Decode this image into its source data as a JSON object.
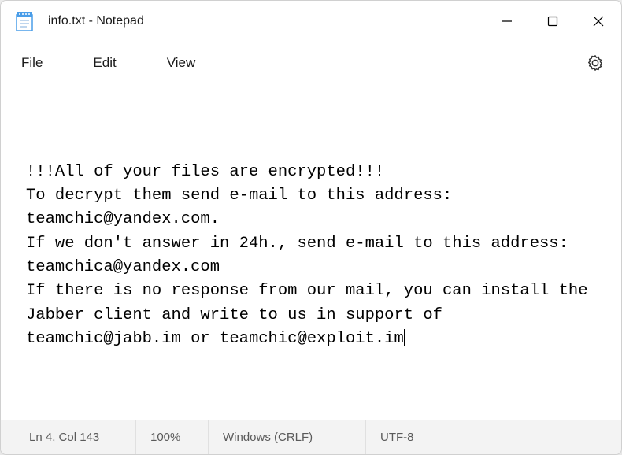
{
  "window": {
    "title": "info.txt - Notepad"
  },
  "menu": {
    "file": "File",
    "edit": "Edit",
    "view": "View"
  },
  "editor": {
    "content": "!!!All of your files are encrypted!!!\nTo decrypt them send e-mail to this address: teamchic@yandex.com.\nIf we don't answer in 24h., send e-mail to this address: teamchica@yandex.com\nIf there is no response from our mail, you can install the Jabber client and write to us in support of teamchic@jabb.im or teamchic@exploit.im"
  },
  "statusbar": {
    "position": "Ln 4, Col 143",
    "zoom": "100%",
    "line_ending": "Windows (CRLF)",
    "encoding": "UTF-8"
  }
}
